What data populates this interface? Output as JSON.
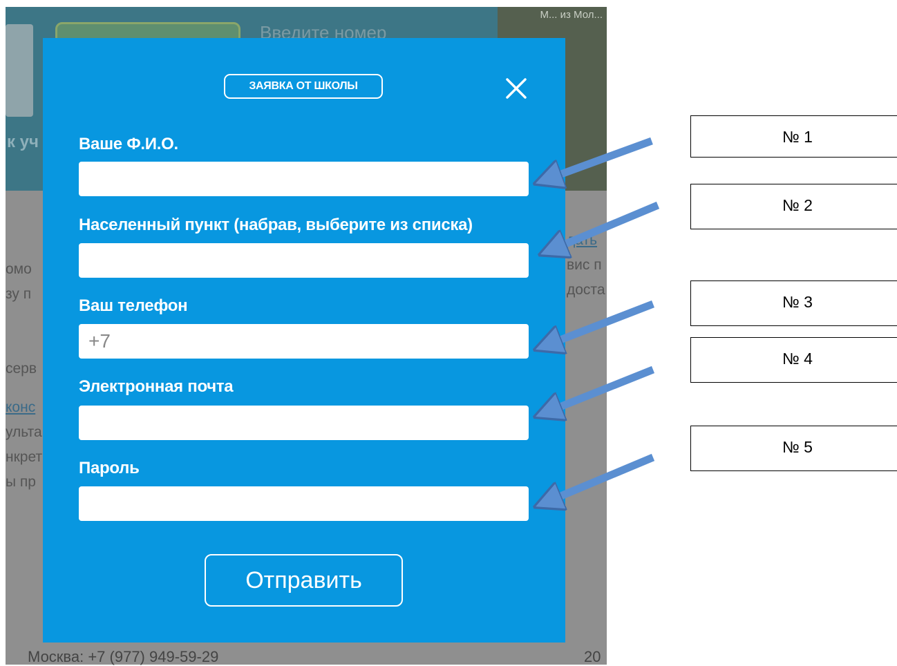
{
  "background_page": {
    "phone_hint": "Введите номер",
    "illustration_text": "М... из Мол...",
    "left_link": "к уч",
    "body_fragments_left": [
      "омо",
      "зу п",
      "",
      "серв",
      "",
      "конс",
      "ульта",
      "нкрет",
      "ы пр"
    ],
    "body_fragments_right": [
      "дать",
      "вис п",
      "доста"
    ],
    "footer_left": "Москва: +7 (977) 949-59-29",
    "footer_right": "20"
  },
  "modal": {
    "badge": "ЗАЯВКА ОТ ШКОЛЫ",
    "close_icon": "close-icon",
    "fields": [
      {
        "label": "Ваше Ф.И.О.",
        "value": "",
        "placeholder": ""
      },
      {
        "label": "Населенный пункт (набрав, выберите из списка)",
        "value": "",
        "placeholder": ""
      },
      {
        "label": "Ваш телефон",
        "value": "",
        "placeholder": "+7"
      },
      {
        "label": "Электронная почта",
        "value": "",
        "placeholder": ""
      },
      {
        "label": "Пароль",
        "value": "",
        "placeholder": ""
      }
    ],
    "submit_label": "Отправить",
    "color": "#0897e0"
  },
  "annotations": [
    {
      "label": "№ 1"
    },
    {
      "label": "№ 2"
    },
    {
      "label": "№ 3"
    },
    {
      "label": "№ 4"
    },
    {
      "label": "№ 5"
    }
  ],
  "arrow_color": "#5b8fd1"
}
